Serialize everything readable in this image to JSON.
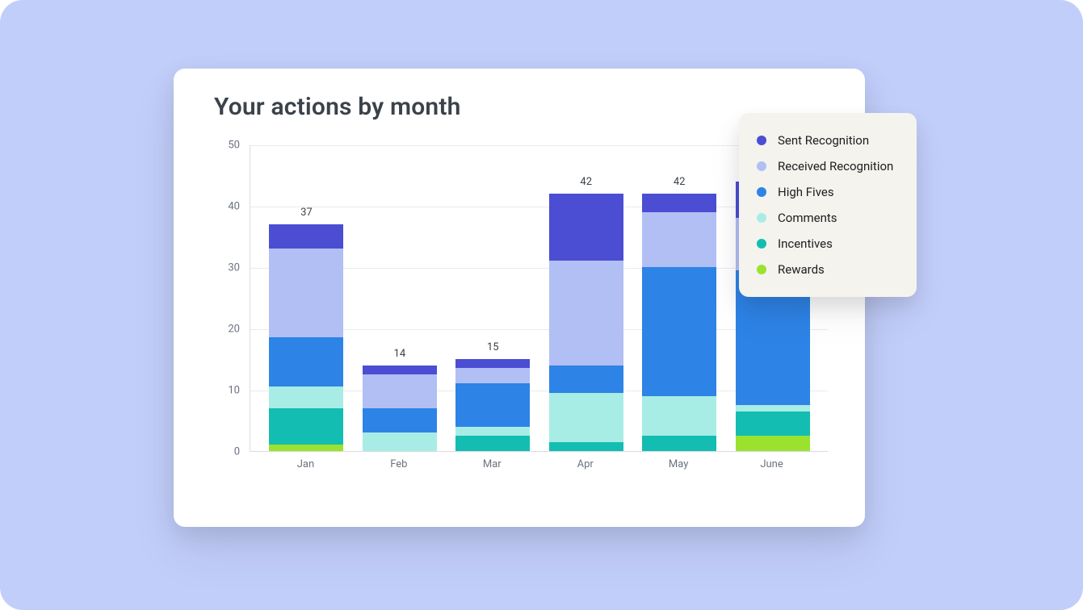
{
  "title": "Your actions by month",
  "legend": [
    {
      "name": "Sent Recognition",
      "color": "#4B4DD3"
    },
    {
      "name": "Received Recognition",
      "color": "#B2BFF4"
    },
    {
      "name": "High Fives",
      "color": "#2E83E6"
    },
    {
      "name": "Comments",
      "color": "#A7EDE5"
    },
    {
      "name": "Incentives",
      "color": "#14BDB1"
    },
    {
      "name": "Rewards",
      "color": "#9BE22F"
    }
  ],
  "y_ticks": [
    0,
    10,
    20,
    30,
    40,
    50
  ],
  "chart_data": {
    "type": "bar",
    "stacked": true,
    "title": "Your actions by month",
    "xlabel": "",
    "ylabel": "",
    "ylim": [
      0,
      50
    ],
    "categories": [
      "Jan",
      "Feb",
      "Mar",
      "Apr",
      "May",
      "June"
    ],
    "series": [
      {
        "name": "Rewards",
        "values": [
          1,
          0,
          0,
          0,
          0,
          2.5
        ]
      },
      {
        "name": "Incentives",
        "values": [
          6,
          0,
          2.5,
          1.5,
          2.5,
          4
        ]
      },
      {
        "name": "Comments",
        "values": [
          3.5,
          3,
          1.5,
          8,
          6.5,
          1
        ]
      },
      {
        "name": "High Fives",
        "values": [
          8,
          4,
          7,
          4.5,
          21,
          22
        ]
      },
      {
        "name": "Received Recognition",
        "values": [
          14.5,
          5.5,
          2.5,
          17,
          9,
          8.5
        ]
      },
      {
        "name": "Sent Recognition",
        "values": [
          4,
          1.5,
          1.5,
          11,
          3,
          6
        ]
      }
    ],
    "totals_labels": [
      37,
      14,
      15,
      42,
      42,
      null
    ]
  }
}
